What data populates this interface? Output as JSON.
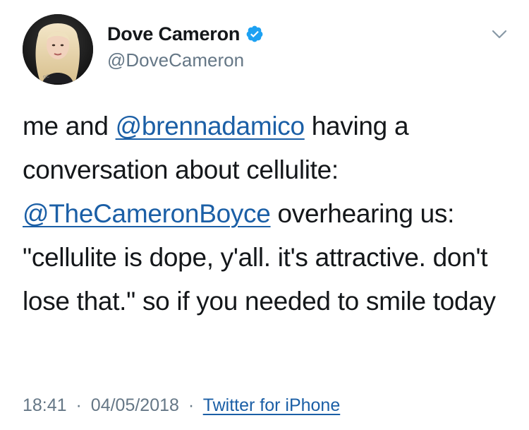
{
  "tweet": {
    "display_name": "Dove Cameron",
    "handle": "@DoveCameron",
    "verified": true,
    "body": {
      "line1_prefix": "me and ",
      "mention1": "@brennadamico",
      "line1_suffix": " having a conversation about cellulite: ",
      "mention2": "@TheCameronBoyce",
      "line2_suffix": " overhearing us: \"cellulite is dope, y'all. it's attractive. don't lose that.\" so if you needed to smile today"
    },
    "time": "18:41",
    "date": "04/05/2018",
    "separator": "·",
    "source": "Twitter for iPhone"
  },
  "icons": {
    "verified": "verified-badge-icon",
    "more": "chevron-down-icon"
  },
  "colors": {
    "verified_blue": "#1da1f2",
    "link_blue": "#1b5fa6",
    "secondary_text": "#657786"
  }
}
